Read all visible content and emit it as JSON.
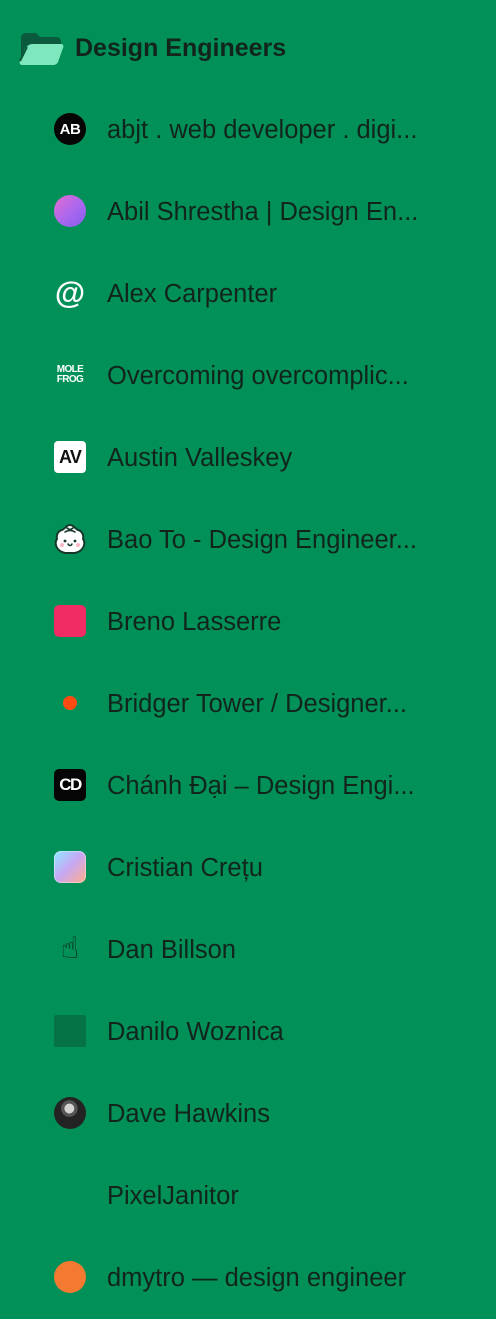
{
  "folder": {
    "title": "Design Engineers",
    "icon": "open-folder-icon"
  },
  "bookmarks": [
    {
      "label": "abjt . web developer . digi...",
      "icon": "abjt-favicon-icon",
      "icon_text": "AB"
    },
    {
      "label": "Abil Shrestha | Design En...",
      "icon": "gradient-circle-favicon-icon"
    },
    {
      "label": "Alex Carpenter",
      "icon": "at-symbol-favicon-icon",
      "icon_text": "@"
    },
    {
      "label": "Overcoming overcomplic...",
      "icon": "mole-frog-favicon-icon",
      "icon_text_line1": "MOLE",
      "icon_text_line2": "FROG"
    },
    {
      "label": "Austin Valleskey",
      "icon": "av-favicon-icon",
      "icon_text": "AV"
    },
    {
      "label": "Bao To - Design Engineer...",
      "icon": "bao-bun-favicon-icon"
    },
    {
      "label": "Breno Lasserre",
      "icon": "red-square-favicon-icon"
    },
    {
      "label": "Bridger Tower / Designer...",
      "icon": "orange-dot-favicon-icon"
    },
    {
      "label": "Chánh Đại – Design Engi...",
      "icon": "cd-favicon-icon",
      "icon_text": "CD"
    },
    {
      "label": "Cristian Crețu",
      "icon": "glass-gradient-favicon-icon"
    },
    {
      "label": "Dan Billson",
      "icon": "hand-favicon-icon",
      "icon_text": "☝"
    },
    {
      "label": "Danilo Woznica",
      "icon": "green-square-favicon-icon"
    },
    {
      "label": "Dave Hawkins",
      "icon": "avatar-favicon-icon"
    },
    {
      "label": "PixelJanitor",
      "icon": "pixel-grid-favicon-icon"
    },
    {
      "label": "dmytro — design engineer",
      "icon": "orange-circle-favicon-icon"
    }
  ],
  "colors": {
    "background": "#019158",
    "text": "#12251d",
    "folder_light": "#7fe7bd",
    "folder_dark": "#0b5a3d"
  }
}
